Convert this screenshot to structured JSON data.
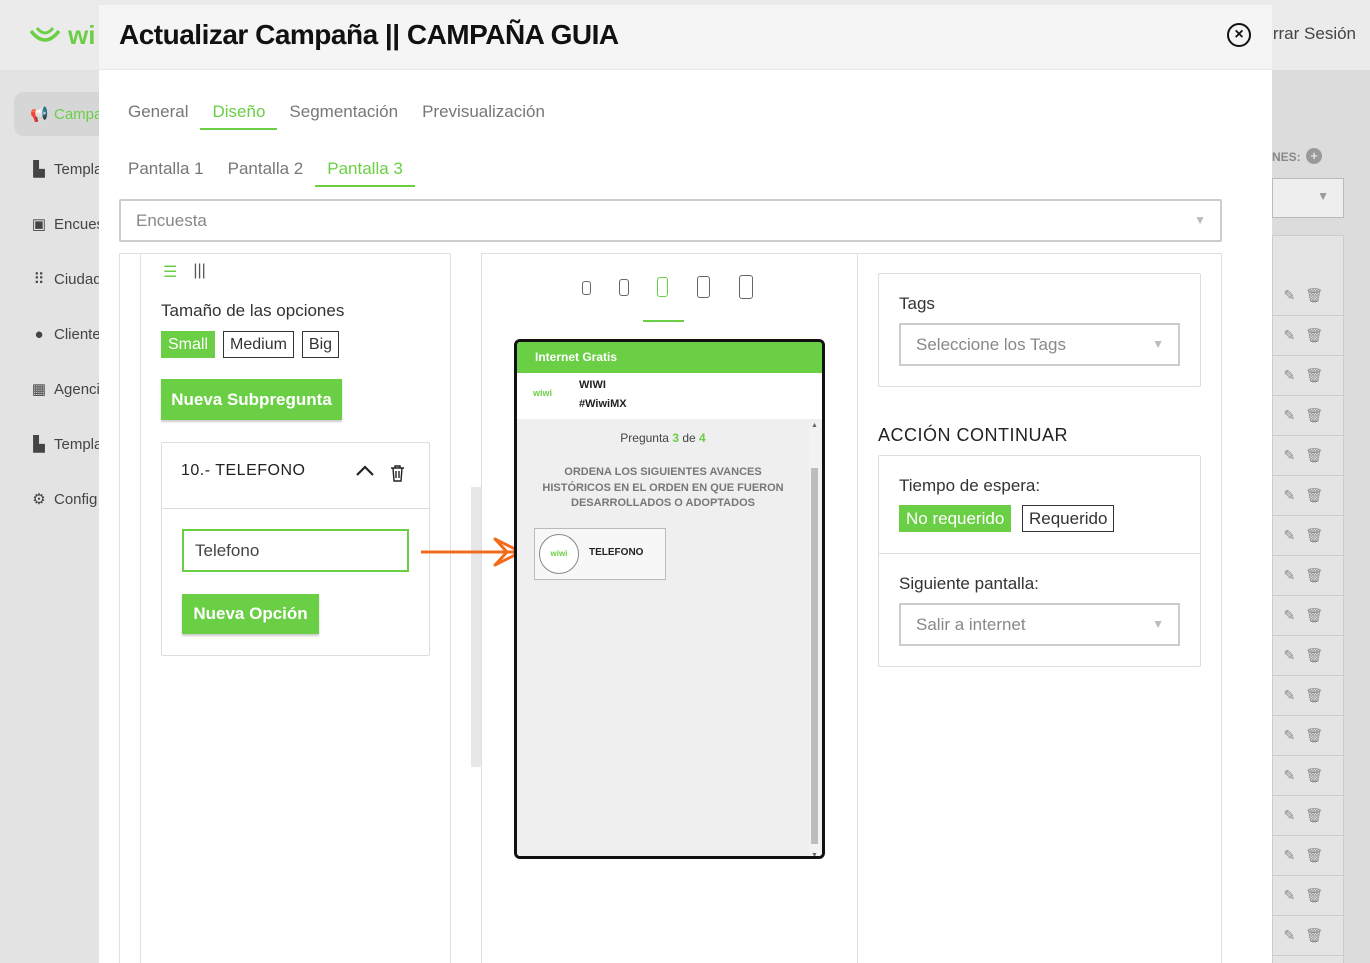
{
  "background": {
    "logo_text": "wi",
    "logout_label": "rrar Sesión",
    "menu": [
      {
        "label": "Campa",
        "icon": "megaphone-icon",
        "active": true
      },
      {
        "label": "Templa",
        "icon": "template-icon"
      },
      {
        "label": "Encues",
        "icon": "clipboard-icon"
      },
      {
        "label": "Ciudad",
        "icon": "grid-dots-icon"
      },
      {
        "label": "Cliente",
        "icon": "users-icon"
      },
      {
        "label": "Agenci",
        "icon": "building-icon"
      },
      {
        "label": "Templa",
        "icon": "template-icon"
      },
      {
        "label": "Config",
        "icon": "gear-icon"
      }
    ],
    "right_label": "NES:"
  },
  "modal": {
    "title": "Actualizar Campaña || CAMPAÑA GUIA",
    "tabs": [
      "General",
      "Diseño",
      "Segmentación",
      "Previsualización"
    ],
    "active_tab": "Diseño",
    "subtabs": [
      "Pantalla 1",
      "Pantalla 2",
      "Pantalla 3"
    ],
    "active_subtab": "Pantalla 3",
    "template_select": "Encuesta"
  },
  "left_panel": {
    "options_size_label": "Tamaño de las opciones",
    "sizes": [
      "Small",
      "Medium",
      "Big"
    ],
    "active_size": "Small",
    "new_subquestion_label": "Nueva Subpregunta",
    "question_title": "10.- TELEFONO",
    "option_value": "Telefono",
    "new_option_label": "Nueva Opción"
  },
  "preview": {
    "active_device": 2,
    "bar_text": "Internet Gratis",
    "brand_logo": "wiwi",
    "brand_name": "WIWI",
    "brand_tag": "#WiwiMX",
    "question_prefix": "Pregunta",
    "question_current": "3",
    "question_of": "de",
    "question_total": "4",
    "question_text": "ORDENA LOS SIGUIENTES AVANCES HISTÓRICOS EN EL ORDEN EN QUE FUERON DESARROLLADOS O ADOPTADOS",
    "option_logo": "wiwi",
    "option_label": "TELEFONO"
  },
  "right_panel": {
    "tags_label": "Tags",
    "tags_placeholder": "Seleccione los Tags",
    "action_title": "ACCIÓN CONTINUAR",
    "wait_label": "Tiempo de espera:",
    "wait_options": [
      "No requerido",
      "Requerido"
    ],
    "wait_active": "No requerido",
    "next_screen_label": "Siguiente pantalla:",
    "next_screen_value": "Salir a internet"
  },
  "colors": {
    "accent": "#6bcf45",
    "arrow": "#f26b1d"
  }
}
